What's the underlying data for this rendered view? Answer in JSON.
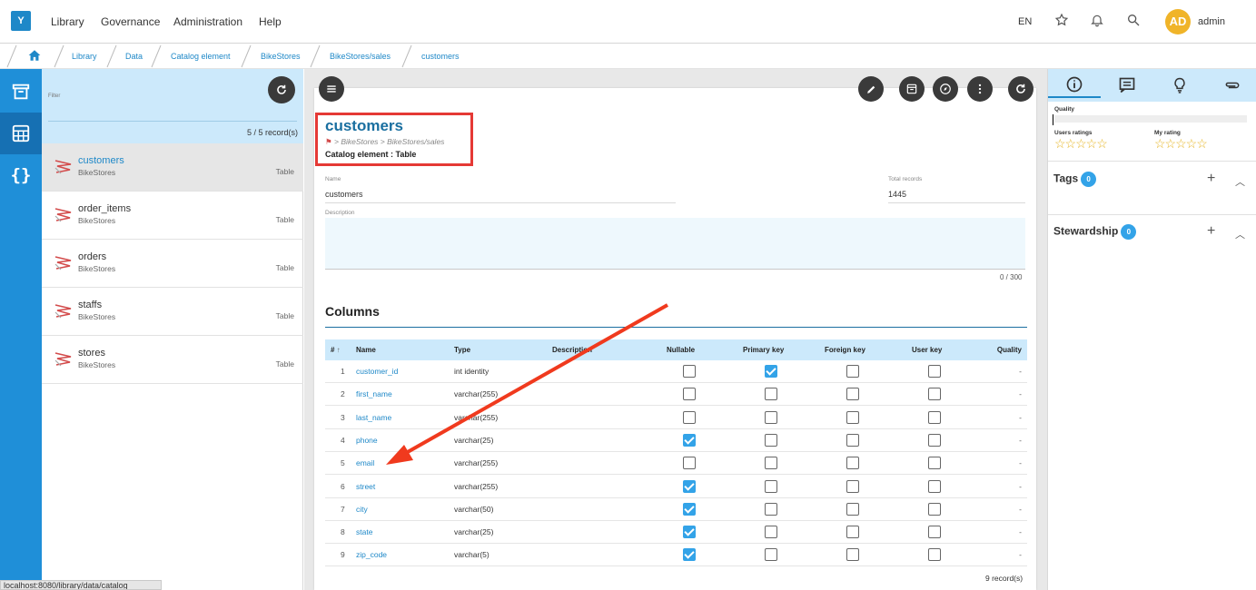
{
  "app": {
    "logo": "Y"
  },
  "menu": [
    "Library",
    "Governance",
    "Administration",
    "Help"
  ],
  "header": {
    "lang": "EN",
    "avatar_initials": "AD",
    "username": "admin"
  },
  "breadcrumb": [
    "Library",
    "Data",
    "Catalog element",
    "BikeStores",
    "BikeStores/sales",
    "customers"
  ],
  "list": {
    "filter_label": "Filter",
    "records": "5 / 5 record(s)",
    "items": [
      {
        "name": "customers",
        "sub": "BikeStores",
        "type": "Table"
      },
      {
        "name": "order_items",
        "sub": "BikeStores",
        "type": "Table"
      },
      {
        "name": "orders",
        "sub": "BikeStores",
        "type": "Table"
      },
      {
        "name": "staffs",
        "sub": "BikeStores",
        "type": "Table"
      },
      {
        "name": "stores",
        "sub": "BikeStores",
        "type": "Table"
      }
    ]
  },
  "status_url": "localhost:8080/library/data/catalog",
  "detail": {
    "title": "customers",
    "path": "> BikeStores > BikeStores/sales",
    "type": "Catalog element : Table",
    "name_label": "Name",
    "name_value": "customers",
    "total_label": "Total records",
    "total_value": "1445",
    "description_label": "Description",
    "description_counter": "0 / 300",
    "columns_title": "Columns",
    "columns_headers": [
      "#",
      "Name",
      "Type",
      "Description",
      "Nullable",
      "Primary key",
      "Foreign key",
      "User key",
      "Quality"
    ],
    "columns": [
      {
        "n": "1",
        "name": "customer_id",
        "type": "int identity",
        "nullable": false,
        "pk": true,
        "fk": false,
        "uk": false,
        "quality": "-"
      },
      {
        "n": "2",
        "name": "first_name",
        "type": "varchar(255)",
        "nullable": false,
        "pk": false,
        "fk": false,
        "uk": false,
        "quality": "-"
      },
      {
        "n": "3",
        "name": "last_name",
        "type": "varchar(255)",
        "nullable": false,
        "pk": false,
        "fk": false,
        "uk": false,
        "quality": "-"
      },
      {
        "n": "4",
        "name": "phone",
        "type": "varchar(25)",
        "nullable": true,
        "pk": false,
        "fk": false,
        "uk": false,
        "quality": "-"
      },
      {
        "n": "5",
        "name": "email",
        "type": "varchar(255)",
        "nullable": false,
        "pk": false,
        "fk": false,
        "uk": false,
        "quality": "-"
      },
      {
        "n": "6",
        "name": "street",
        "type": "varchar(255)",
        "nullable": true,
        "pk": false,
        "fk": false,
        "uk": false,
        "quality": "-"
      },
      {
        "n": "7",
        "name": "city",
        "type": "varchar(50)",
        "nullable": true,
        "pk": false,
        "fk": false,
        "uk": false,
        "quality": "-"
      },
      {
        "n": "8",
        "name": "state",
        "type": "varchar(25)",
        "nullable": true,
        "pk": false,
        "fk": false,
        "uk": false,
        "quality": "-"
      },
      {
        "n": "9",
        "name": "zip_code",
        "type": "varchar(5)",
        "nullable": true,
        "pk": false,
        "fk": false,
        "uk": false,
        "quality": "-"
      }
    ],
    "columns_records": "9 record(s)"
  },
  "right": {
    "quality_label": "Quality",
    "users_ratings_label": "Users ratings",
    "my_rating_label": "My rating",
    "stars": "☆☆☆☆☆",
    "tags_label": "Tags",
    "tags_count": "0",
    "stewardship_label": "Stewardship",
    "stewardship_count": "0"
  },
  "colors": {
    "accent": "#1e88c8",
    "rail": "#1f8fd8",
    "highlight": "#e53935",
    "check": "#33a3e8"
  }
}
